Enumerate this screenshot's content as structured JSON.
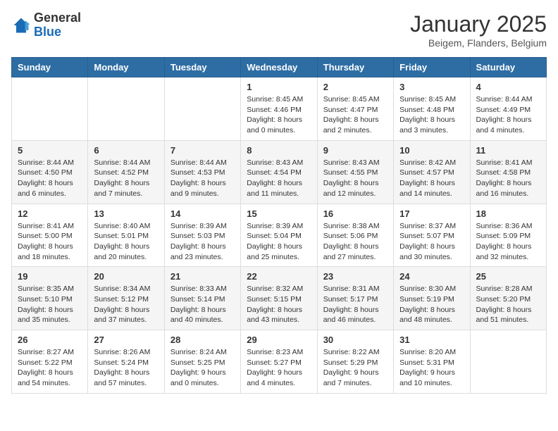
{
  "logo": {
    "general": "General",
    "blue": "Blue"
  },
  "header": {
    "month": "January 2025",
    "location": "Beigem, Flanders, Belgium"
  },
  "weekdays": [
    "Sunday",
    "Monday",
    "Tuesday",
    "Wednesday",
    "Thursday",
    "Friday",
    "Saturday"
  ],
  "weeks": [
    [
      {
        "day": "",
        "info": ""
      },
      {
        "day": "",
        "info": ""
      },
      {
        "day": "",
        "info": ""
      },
      {
        "day": "1",
        "info": "Sunrise: 8:45 AM\nSunset: 4:46 PM\nDaylight: 8 hours and 0 minutes."
      },
      {
        "day": "2",
        "info": "Sunrise: 8:45 AM\nSunset: 4:47 PM\nDaylight: 8 hours and 2 minutes."
      },
      {
        "day": "3",
        "info": "Sunrise: 8:45 AM\nSunset: 4:48 PM\nDaylight: 8 hours and 3 minutes."
      },
      {
        "day": "4",
        "info": "Sunrise: 8:44 AM\nSunset: 4:49 PM\nDaylight: 8 hours and 4 minutes."
      }
    ],
    [
      {
        "day": "5",
        "info": "Sunrise: 8:44 AM\nSunset: 4:50 PM\nDaylight: 8 hours and 6 minutes."
      },
      {
        "day": "6",
        "info": "Sunrise: 8:44 AM\nSunset: 4:52 PM\nDaylight: 8 hours and 7 minutes."
      },
      {
        "day": "7",
        "info": "Sunrise: 8:44 AM\nSunset: 4:53 PM\nDaylight: 8 hours and 9 minutes."
      },
      {
        "day": "8",
        "info": "Sunrise: 8:43 AM\nSunset: 4:54 PM\nDaylight: 8 hours and 11 minutes."
      },
      {
        "day": "9",
        "info": "Sunrise: 8:43 AM\nSunset: 4:55 PM\nDaylight: 8 hours and 12 minutes."
      },
      {
        "day": "10",
        "info": "Sunrise: 8:42 AM\nSunset: 4:57 PM\nDaylight: 8 hours and 14 minutes."
      },
      {
        "day": "11",
        "info": "Sunrise: 8:41 AM\nSunset: 4:58 PM\nDaylight: 8 hours and 16 minutes."
      }
    ],
    [
      {
        "day": "12",
        "info": "Sunrise: 8:41 AM\nSunset: 5:00 PM\nDaylight: 8 hours and 18 minutes."
      },
      {
        "day": "13",
        "info": "Sunrise: 8:40 AM\nSunset: 5:01 PM\nDaylight: 8 hours and 20 minutes."
      },
      {
        "day": "14",
        "info": "Sunrise: 8:39 AM\nSunset: 5:03 PM\nDaylight: 8 hours and 23 minutes."
      },
      {
        "day": "15",
        "info": "Sunrise: 8:39 AM\nSunset: 5:04 PM\nDaylight: 8 hours and 25 minutes."
      },
      {
        "day": "16",
        "info": "Sunrise: 8:38 AM\nSunset: 5:06 PM\nDaylight: 8 hours and 27 minutes."
      },
      {
        "day": "17",
        "info": "Sunrise: 8:37 AM\nSunset: 5:07 PM\nDaylight: 8 hours and 30 minutes."
      },
      {
        "day": "18",
        "info": "Sunrise: 8:36 AM\nSunset: 5:09 PM\nDaylight: 8 hours and 32 minutes."
      }
    ],
    [
      {
        "day": "19",
        "info": "Sunrise: 8:35 AM\nSunset: 5:10 PM\nDaylight: 8 hours and 35 minutes."
      },
      {
        "day": "20",
        "info": "Sunrise: 8:34 AM\nSunset: 5:12 PM\nDaylight: 8 hours and 37 minutes."
      },
      {
        "day": "21",
        "info": "Sunrise: 8:33 AM\nSunset: 5:14 PM\nDaylight: 8 hours and 40 minutes."
      },
      {
        "day": "22",
        "info": "Sunrise: 8:32 AM\nSunset: 5:15 PM\nDaylight: 8 hours and 43 minutes."
      },
      {
        "day": "23",
        "info": "Sunrise: 8:31 AM\nSunset: 5:17 PM\nDaylight: 8 hours and 46 minutes."
      },
      {
        "day": "24",
        "info": "Sunrise: 8:30 AM\nSunset: 5:19 PM\nDaylight: 8 hours and 48 minutes."
      },
      {
        "day": "25",
        "info": "Sunrise: 8:28 AM\nSunset: 5:20 PM\nDaylight: 8 hours and 51 minutes."
      }
    ],
    [
      {
        "day": "26",
        "info": "Sunrise: 8:27 AM\nSunset: 5:22 PM\nDaylight: 8 hours and 54 minutes."
      },
      {
        "day": "27",
        "info": "Sunrise: 8:26 AM\nSunset: 5:24 PM\nDaylight: 8 hours and 57 minutes."
      },
      {
        "day": "28",
        "info": "Sunrise: 8:24 AM\nSunset: 5:25 PM\nDaylight: 9 hours and 0 minutes."
      },
      {
        "day": "29",
        "info": "Sunrise: 8:23 AM\nSunset: 5:27 PM\nDaylight: 9 hours and 4 minutes."
      },
      {
        "day": "30",
        "info": "Sunrise: 8:22 AM\nSunset: 5:29 PM\nDaylight: 9 hours and 7 minutes."
      },
      {
        "day": "31",
        "info": "Sunrise: 8:20 AM\nSunset: 5:31 PM\nDaylight: 9 hours and 10 minutes."
      },
      {
        "day": "",
        "info": ""
      }
    ]
  ]
}
